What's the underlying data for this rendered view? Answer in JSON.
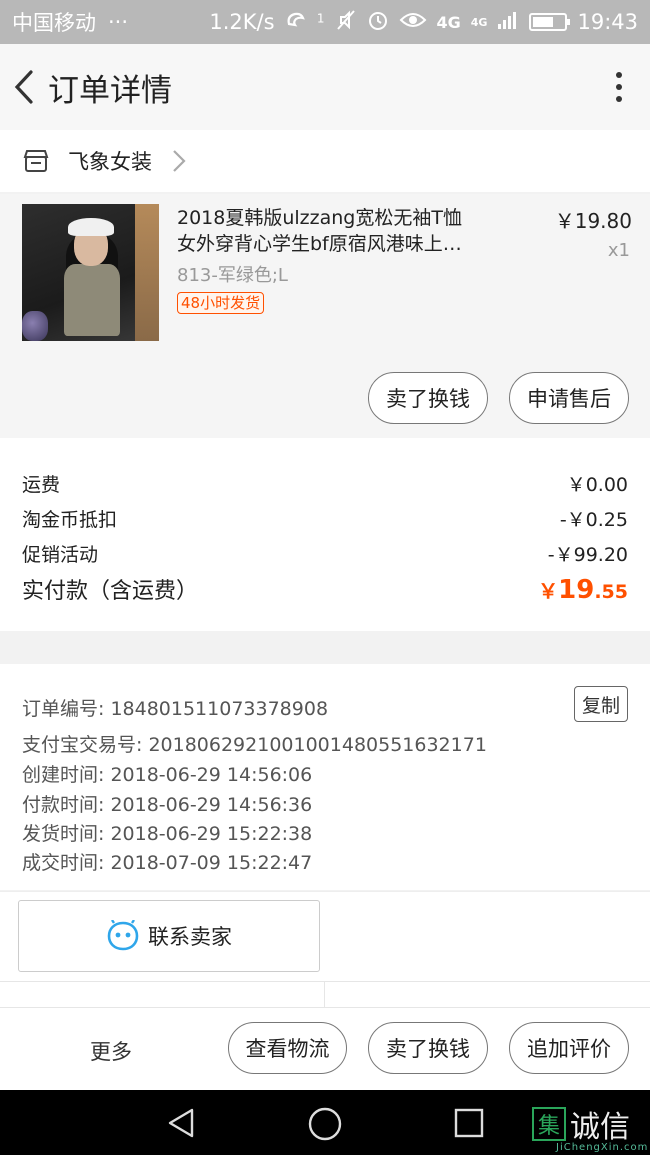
{
  "status_bar": {
    "carrier": "中国移动",
    "dots": "···",
    "speed": "1.2K/s",
    "hd_badge": "1",
    "net_label": "4G",
    "net_label2": "4G",
    "time": "19:43",
    "battery_level": 0.65
  },
  "nav": {
    "title": "订单详情"
  },
  "shop": {
    "name": "飞象女装"
  },
  "item": {
    "title_line1": "2018夏韩版ulzzang宽松无袖T恤",
    "title_line2": "女外穿背心学生bf原宿风港味上…",
    "sku": "813-军绿色;L",
    "tag": "48小时发货",
    "price": "￥19.80",
    "qty": "x1",
    "btn_exchange": "卖了换钱",
    "btn_aftersale": "申请售后"
  },
  "fees": {
    "shipping_label": "运费",
    "shipping_value": "￥0.00",
    "coin_label": "淘金币抵扣",
    "coin_value": "-￥0.25",
    "promo_label": "促销活动",
    "promo_value": "-￥99.20",
    "total_label": "实付款（含运费）",
    "total_currency": "￥",
    "total_main": "19",
    "total_cents": ".55"
  },
  "order_info": {
    "order_no": "订单编号: 184801511073378908",
    "copy": "复制",
    "alipay_no": "支付宝交易号: 2018062921001001480551632171",
    "created": "创建时间: 2018-06-29 14:56:06",
    "paid": "付款时间: 2018-06-29 14:56:36",
    "shipped": "发货时间: 2018-06-29 15:22:38",
    "completed": "成交时间: 2018-07-09 15:22:47"
  },
  "contact": {
    "label": "联系卖家"
  },
  "actions": {
    "more": "更多",
    "logistics": "查看物流",
    "exchange": "卖了换钱",
    "review": "追加评价"
  },
  "watermark": {
    "glyph": "集",
    "text": "诚信",
    "sub": "JiChengXin.com"
  },
  "colors": {
    "accent": "#ff5000",
    "status_bar": "#b8b8b8",
    "contact_icon": "#2fa6ea"
  }
}
